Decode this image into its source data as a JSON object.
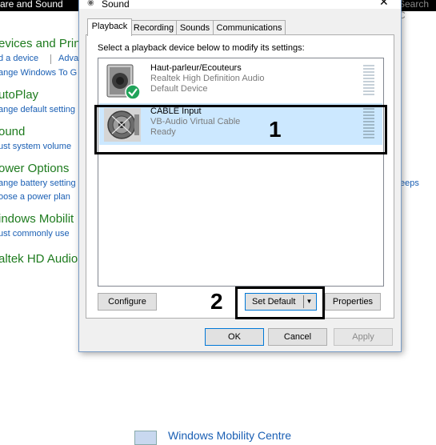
{
  "background": {
    "title_fragment": "are and Sound",
    "search_fragment": "Search C",
    "sections": [
      {
        "heading": "evices and Print",
        "links": [
          "d a device",
          "Adva",
          "ange Windows To G"
        ]
      },
      {
        "heading": "utoPlay",
        "links": [
          "ange default setting"
        ]
      },
      {
        "heading": "ound",
        "links": [
          "ust system volume"
        ]
      },
      {
        "heading": "ower Options",
        "links": [
          "ange battery setting",
          "oose a power plan"
        ],
        "right_fragment": "eeps"
      },
      {
        "heading": "indows Mobilit",
        "links": [
          "ust commonly use"
        ]
      },
      {
        "heading": "altek HD Audio",
        "links": []
      }
    ],
    "bottom_fragment": "Windows Mobility Centre"
  },
  "dialog": {
    "title": "Sound",
    "close_glyph": "✕",
    "tabs": [
      {
        "label": "Playback",
        "active": true
      },
      {
        "label": "Recording",
        "active": false
      },
      {
        "label": "Sounds",
        "active": false
      },
      {
        "label": "Communications",
        "active": false
      }
    ],
    "instruction": "Select a playback device below to modify its settings:",
    "devices": [
      {
        "name": "Haut-parleur/Ecouteurs",
        "driver": "Realtek High Definition Audio",
        "status": "Default Device",
        "icon": "speaker-icon",
        "selected": false,
        "default_badge": true
      },
      {
        "name": "CABLE Input",
        "driver": "VB-Audio Virtual Cable",
        "status": "Ready",
        "icon": "cable-icon",
        "selected": true,
        "default_badge": false
      }
    ],
    "buttons": {
      "configure": "Configure",
      "set_default": "Set Default",
      "properties": "Properties",
      "ok": "OK",
      "cancel": "Cancel",
      "apply": "Apply"
    }
  },
  "annotations": {
    "one": "1",
    "two": "2"
  }
}
